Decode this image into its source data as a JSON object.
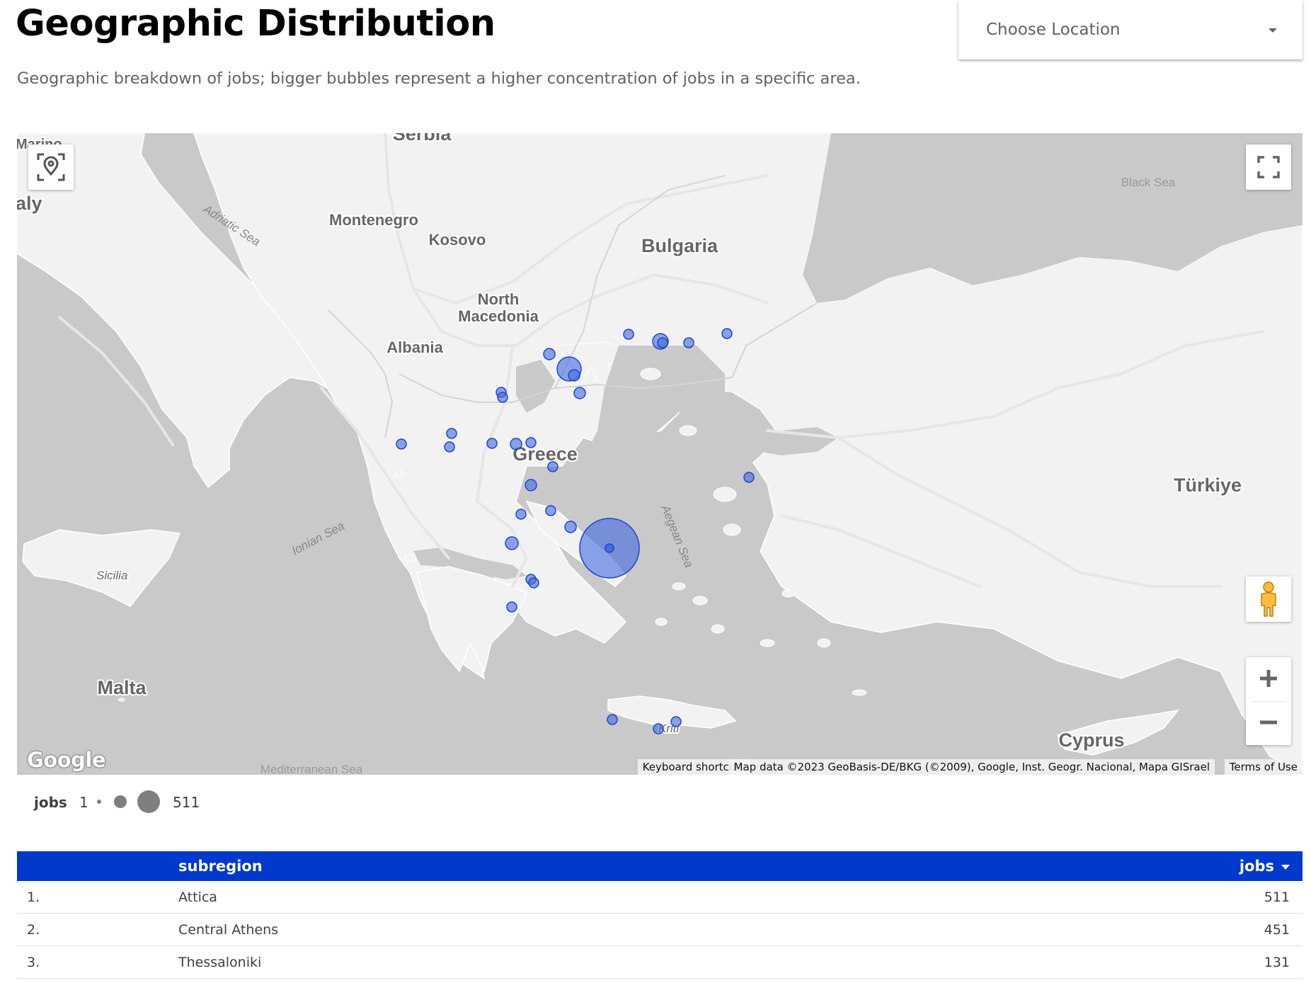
{
  "header": {
    "title": "Geographic Distribution",
    "subtitle": "Geographic breakdown of jobs; bigger bubbles represent a higher concentration of jobs in a specific area.",
    "location_dropdown": "Choose Location"
  },
  "map": {
    "labels": {
      "serbia": "Serbia",
      "marino": "Marino",
      "italy": "aly",
      "montenegro": "Montenegro",
      "kosovo": "Kosovo",
      "bulgaria": "Bulgaria",
      "north_macedonia_1": "North",
      "north_macedonia_2": "Macedonia",
      "albania": "Albania",
      "greece": "Greece",
      "turkiye": "Türkiye",
      "black_sea": "Black Sea",
      "adriatic_sea": "Adriatic Sea",
      "ionian_sea": "Ionian Sea",
      "aegean_sea": "Aegean Sea",
      "sicilia": "Sicilia",
      "malta": "Malta",
      "kriti": "Kriti",
      "cyprus": "Cyprus",
      "mediterranean_sea": "Mediterranean Sea"
    },
    "attribution": {
      "keyboard": "Keyboard shortcuts",
      "data": "Map data ©2023 GeoBasis-DE/BKG (©2009), Google, Inst. Geogr. Nacional, Mapa GISrael",
      "terms": "Terms of Use"
    },
    "logo": "Google",
    "bubble_color": "#4169e1"
  },
  "legend": {
    "metric": "jobs",
    "min": "1",
    "max": "511"
  },
  "table": {
    "columns": {
      "dimension": "subregion",
      "metric": "jobs"
    },
    "rows": [
      {
        "index": "1.",
        "subregion": "Attica",
        "jobs": "511"
      },
      {
        "index": "2.",
        "subregion": "Central Athens",
        "jobs": "451"
      },
      {
        "index": "3.",
        "subregion": "Thessaloniki",
        "jobs": "131"
      }
    ]
  }
}
